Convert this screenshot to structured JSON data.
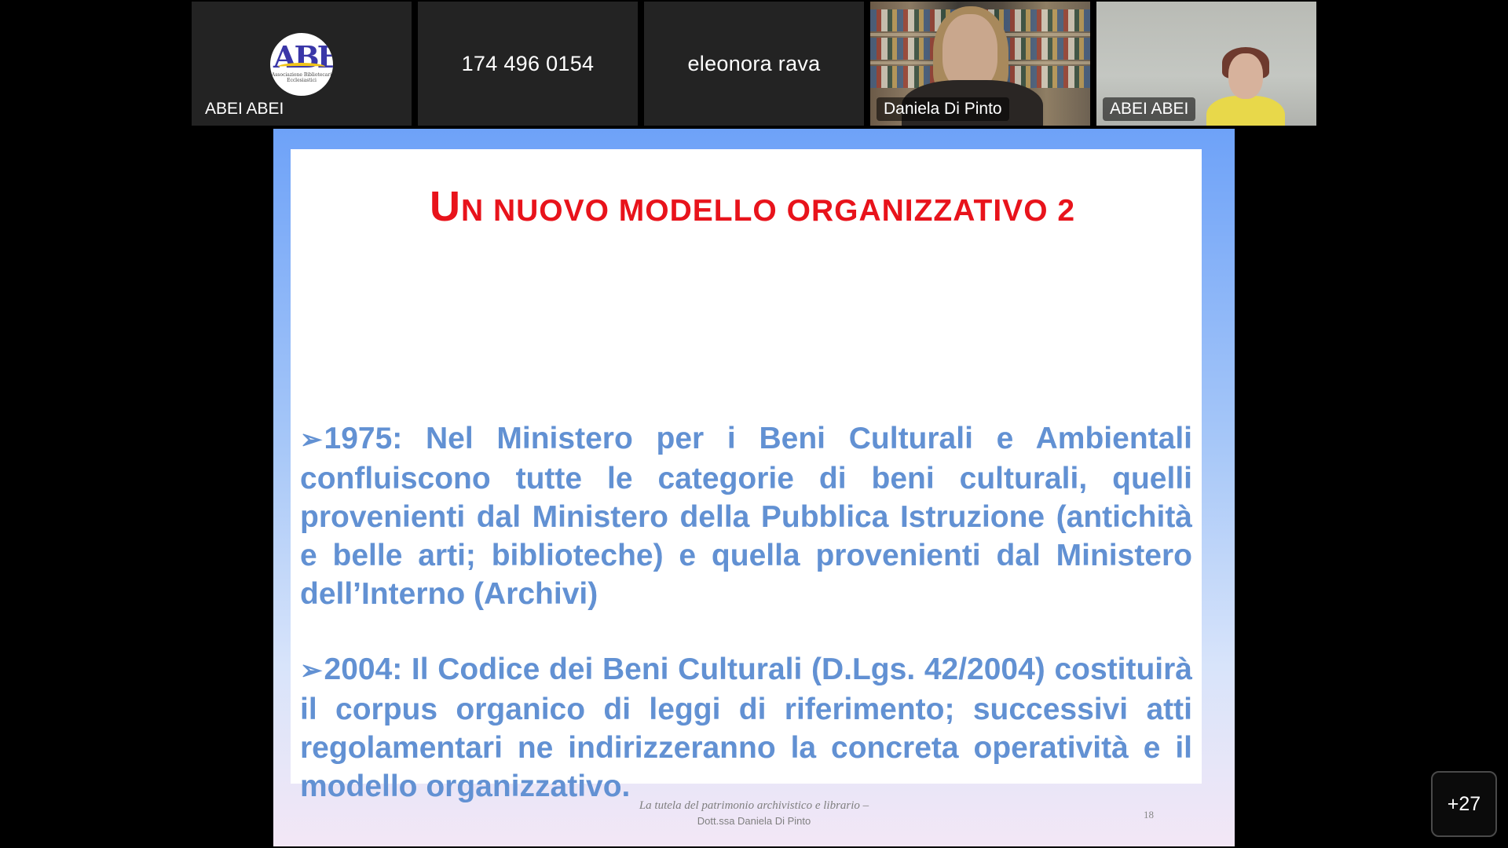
{
  "participants": [
    {
      "name": "ABEI ABEI",
      "type": "logo",
      "logo_text": "ABE",
      "logo_subtext": "Associazione Bibliotecari Ecclesiastici"
    },
    {
      "name": "174 496 0154",
      "type": "name-only"
    },
    {
      "name": "eleonora rava",
      "type": "name-only"
    },
    {
      "name": "Daniela Di Pinto",
      "type": "video"
    },
    {
      "name": "ABEI ABEI",
      "type": "video"
    }
  ],
  "slide": {
    "title_first_letter": "U",
    "title_rest": "N NUOVO MODELLO ORGANIZZATIVO 2",
    "bullets": [
      {
        "marker": "➢",
        "text": "1975: Nel Ministero per i Beni Culturali e Ambientali confluiscono tutte le categorie di beni culturali, quelli provenienti dal Ministero della Pubblica Istruzione (antichità e belle arti; biblioteche) e quella provenienti dal Ministero dell’Interno (Archivi)"
      },
      {
        "marker": "➢",
        "text": "2004: Il Codice dei Beni Culturali (D.Lgs. 42/2004) costituirà il corpus organico di leggi di riferimento; successivi atti regolamentari ne indirizzeranno la concreta operatività e il modello organizzativo."
      }
    ],
    "footer_line1": "La tutela del patrimonio archivistico e librario –",
    "footer_line2": "Dott.ssa Daniela Di Pinto",
    "page_number": "18",
    "colors": {
      "title": "#e8131b",
      "bullet_text": "#6291d3"
    }
  },
  "more_participants": "+27"
}
